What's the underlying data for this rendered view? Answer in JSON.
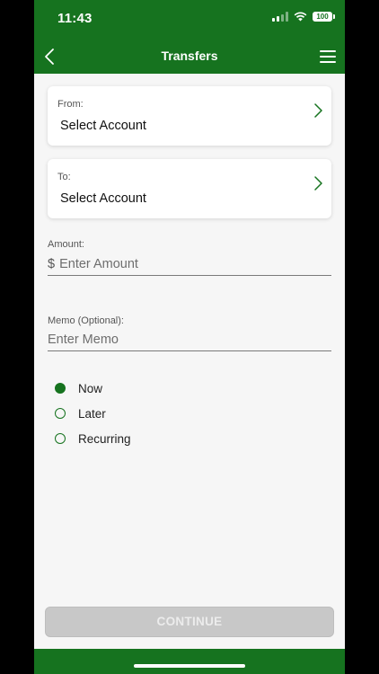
{
  "status_bar": {
    "time": "11:43",
    "battery": "100"
  },
  "nav": {
    "title": "Transfers",
    "back_icon": "chevron-left-icon",
    "menu_icon": "hamburger-menu-icon"
  },
  "from": {
    "label": "From:",
    "value": "Select Account"
  },
  "to": {
    "label": "To:",
    "value": "Select Account"
  },
  "amount": {
    "label": "Amount:",
    "currency": "$",
    "placeholder": "Enter Amount"
  },
  "memo": {
    "label": "Memo (Optional):",
    "placeholder": "Enter Memo"
  },
  "schedule_options": [
    {
      "label": "Now",
      "selected": true
    },
    {
      "label": "Later",
      "selected": false
    },
    {
      "label": "Recurring",
      "selected": false
    }
  ],
  "continue": {
    "label": "CONTINUE",
    "enabled": false
  },
  "colors": {
    "brand_green": "#16731f",
    "disabled_button": "#c8c8c8",
    "background": "#f6f6f6"
  }
}
